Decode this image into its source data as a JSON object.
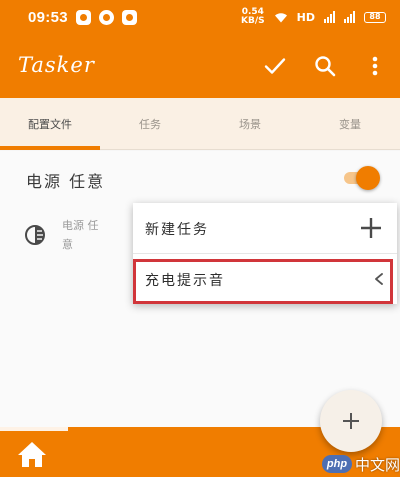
{
  "status_bar": {
    "time": "09:53",
    "net_speed": "0.54",
    "net_unit": "KB/S",
    "network_label": "HD",
    "battery": "88"
  },
  "app_bar": {
    "title": "Tasker",
    "icons": [
      "check-icon",
      "search-icon",
      "more-vert-icon"
    ]
  },
  "tabs": [
    {
      "label": "配置文件",
      "active": true
    },
    {
      "label": "任务",
      "active": false
    },
    {
      "label": "场景",
      "active": false
    },
    {
      "label": "变量",
      "active": false
    }
  ],
  "profile": {
    "name": "电源 任意",
    "enabled": true,
    "context_label": "电源 任意",
    "context_icon": "power-context-icon"
  },
  "popup_menu": {
    "items": [
      {
        "label": "新建任务",
        "icon": "plus-icon"
      },
      {
        "label": "充电提示音",
        "icon": "chevron-left-icon",
        "highlighted": true
      }
    ]
  },
  "bottom_bar": {
    "icon": "home-icon"
  },
  "fab": {
    "icon": "plus-icon"
  },
  "watermark": {
    "logo": "php",
    "text": "中文网"
  },
  "colors": {
    "accent": "#f07d00",
    "tab_background": "#faf0e4",
    "highlight_border": "#d1353a"
  }
}
